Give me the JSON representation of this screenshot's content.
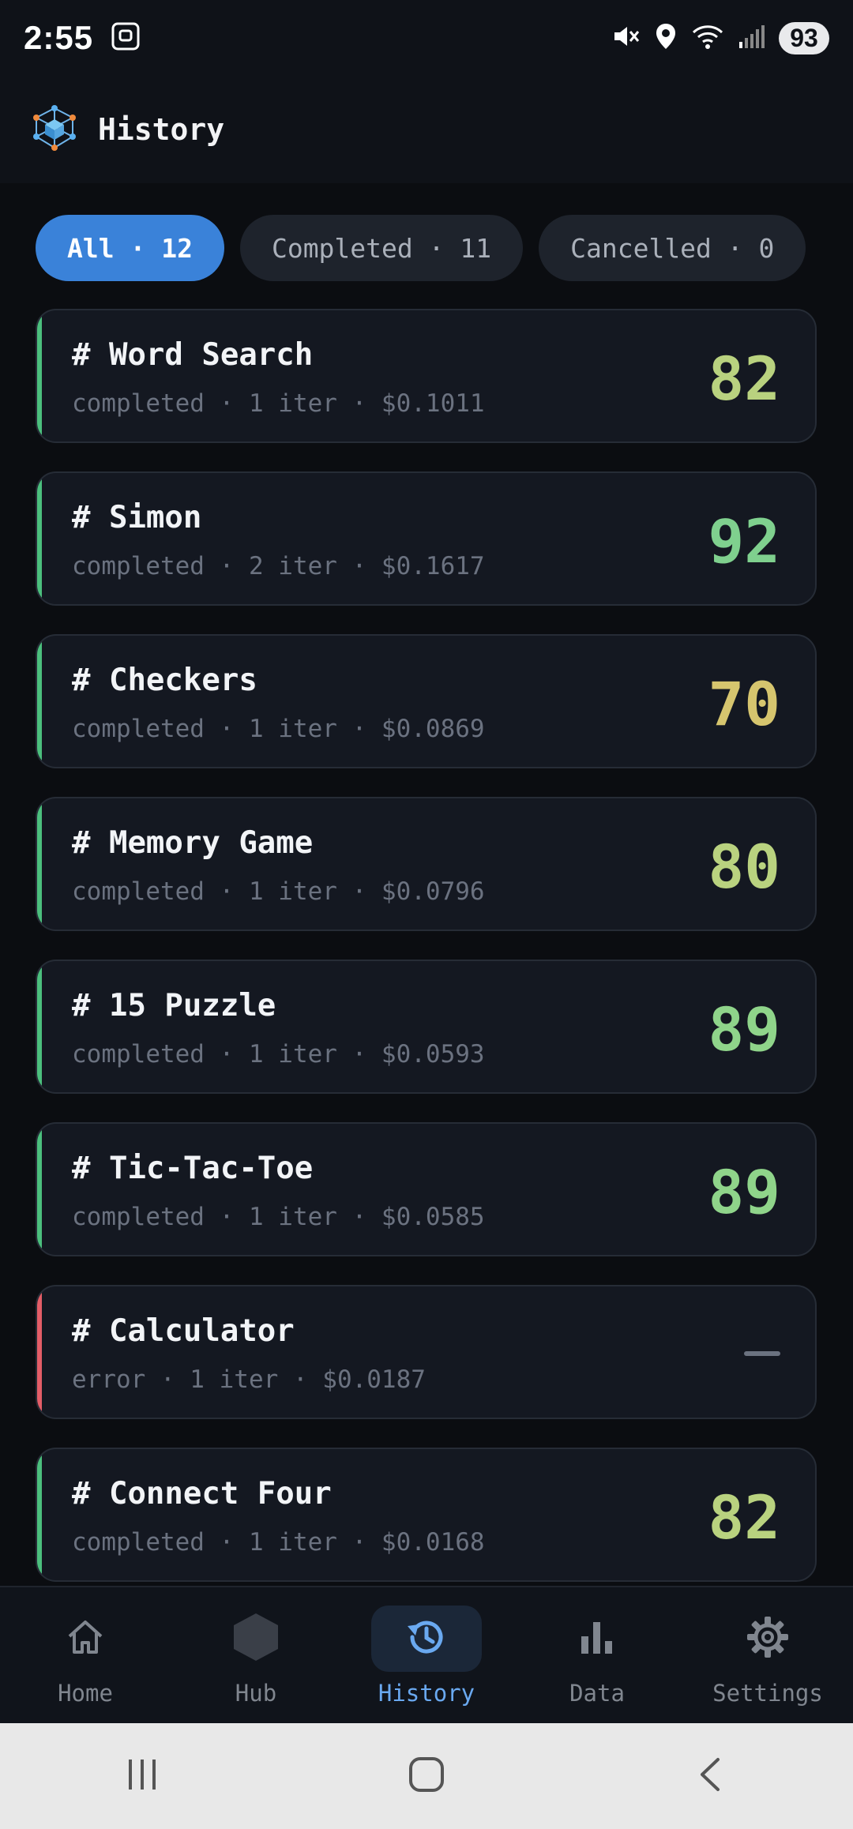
{
  "status": {
    "time": "2:55",
    "battery": "93"
  },
  "header": {
    "title": "History"
  },
  "filters": [
    {
      "label": "All · 12",
      "active": true
    },
    {
      "label": "Completed · 11",
      "active": false
    },
    {
      "label": "Cancelled · 0",
      "active": false
    }
  ],
  "items": [
    {
      "title": "# Word Search",
      "meta": "completed · 1 iter · $0.1011",
      "score": "82"
    },
    {
      "title": "# Simon",
      "meta": "completed · 2 iter · $0.1617",
      "score": "92"
    },
    {
      "title": "# Checkers",
      "meta": "completed · 1 iter · $0.0869",
      "score": "70"
    },
    {
      "title": "# Memory Game",
      "meta": "completed · 1 iter · $0.0796",
      "score": "80"
    },
    {
      "title": "# 15 Puzzle",
      "meta": "completed · 1 iter · $0.0593",
      "score": "89"
    },
    {
      "title": "# Tic-Tac-Toe",
      "meta": "completed · 1 iter · $0.0585",
      "score": "89"
    },
    {
      "title": "# Calculator",
      "meta": "error · 1 iter · $0.0187",
      "score": "—"
    },
    {
      "title": "# Connect Four",
      "meta": "completed · 1 iter · $0.0168",
      "score": "82"
    }
  ],
  "nav": {
    "home": "Home",
    "hub": "Hub",
    "history": "History",
    "data": "Data",
    "settings": "Settings"
  },
  "colors": {
    "accent": "#3a82d9",
    "success_stripe": "#4bbf7d",
    "error_stripe": "#e35d67",
    "score_high": "#7fd08e",
    "score_mid": "#b9d27f",
    "score_low": "#d6c56e"
  }
}
